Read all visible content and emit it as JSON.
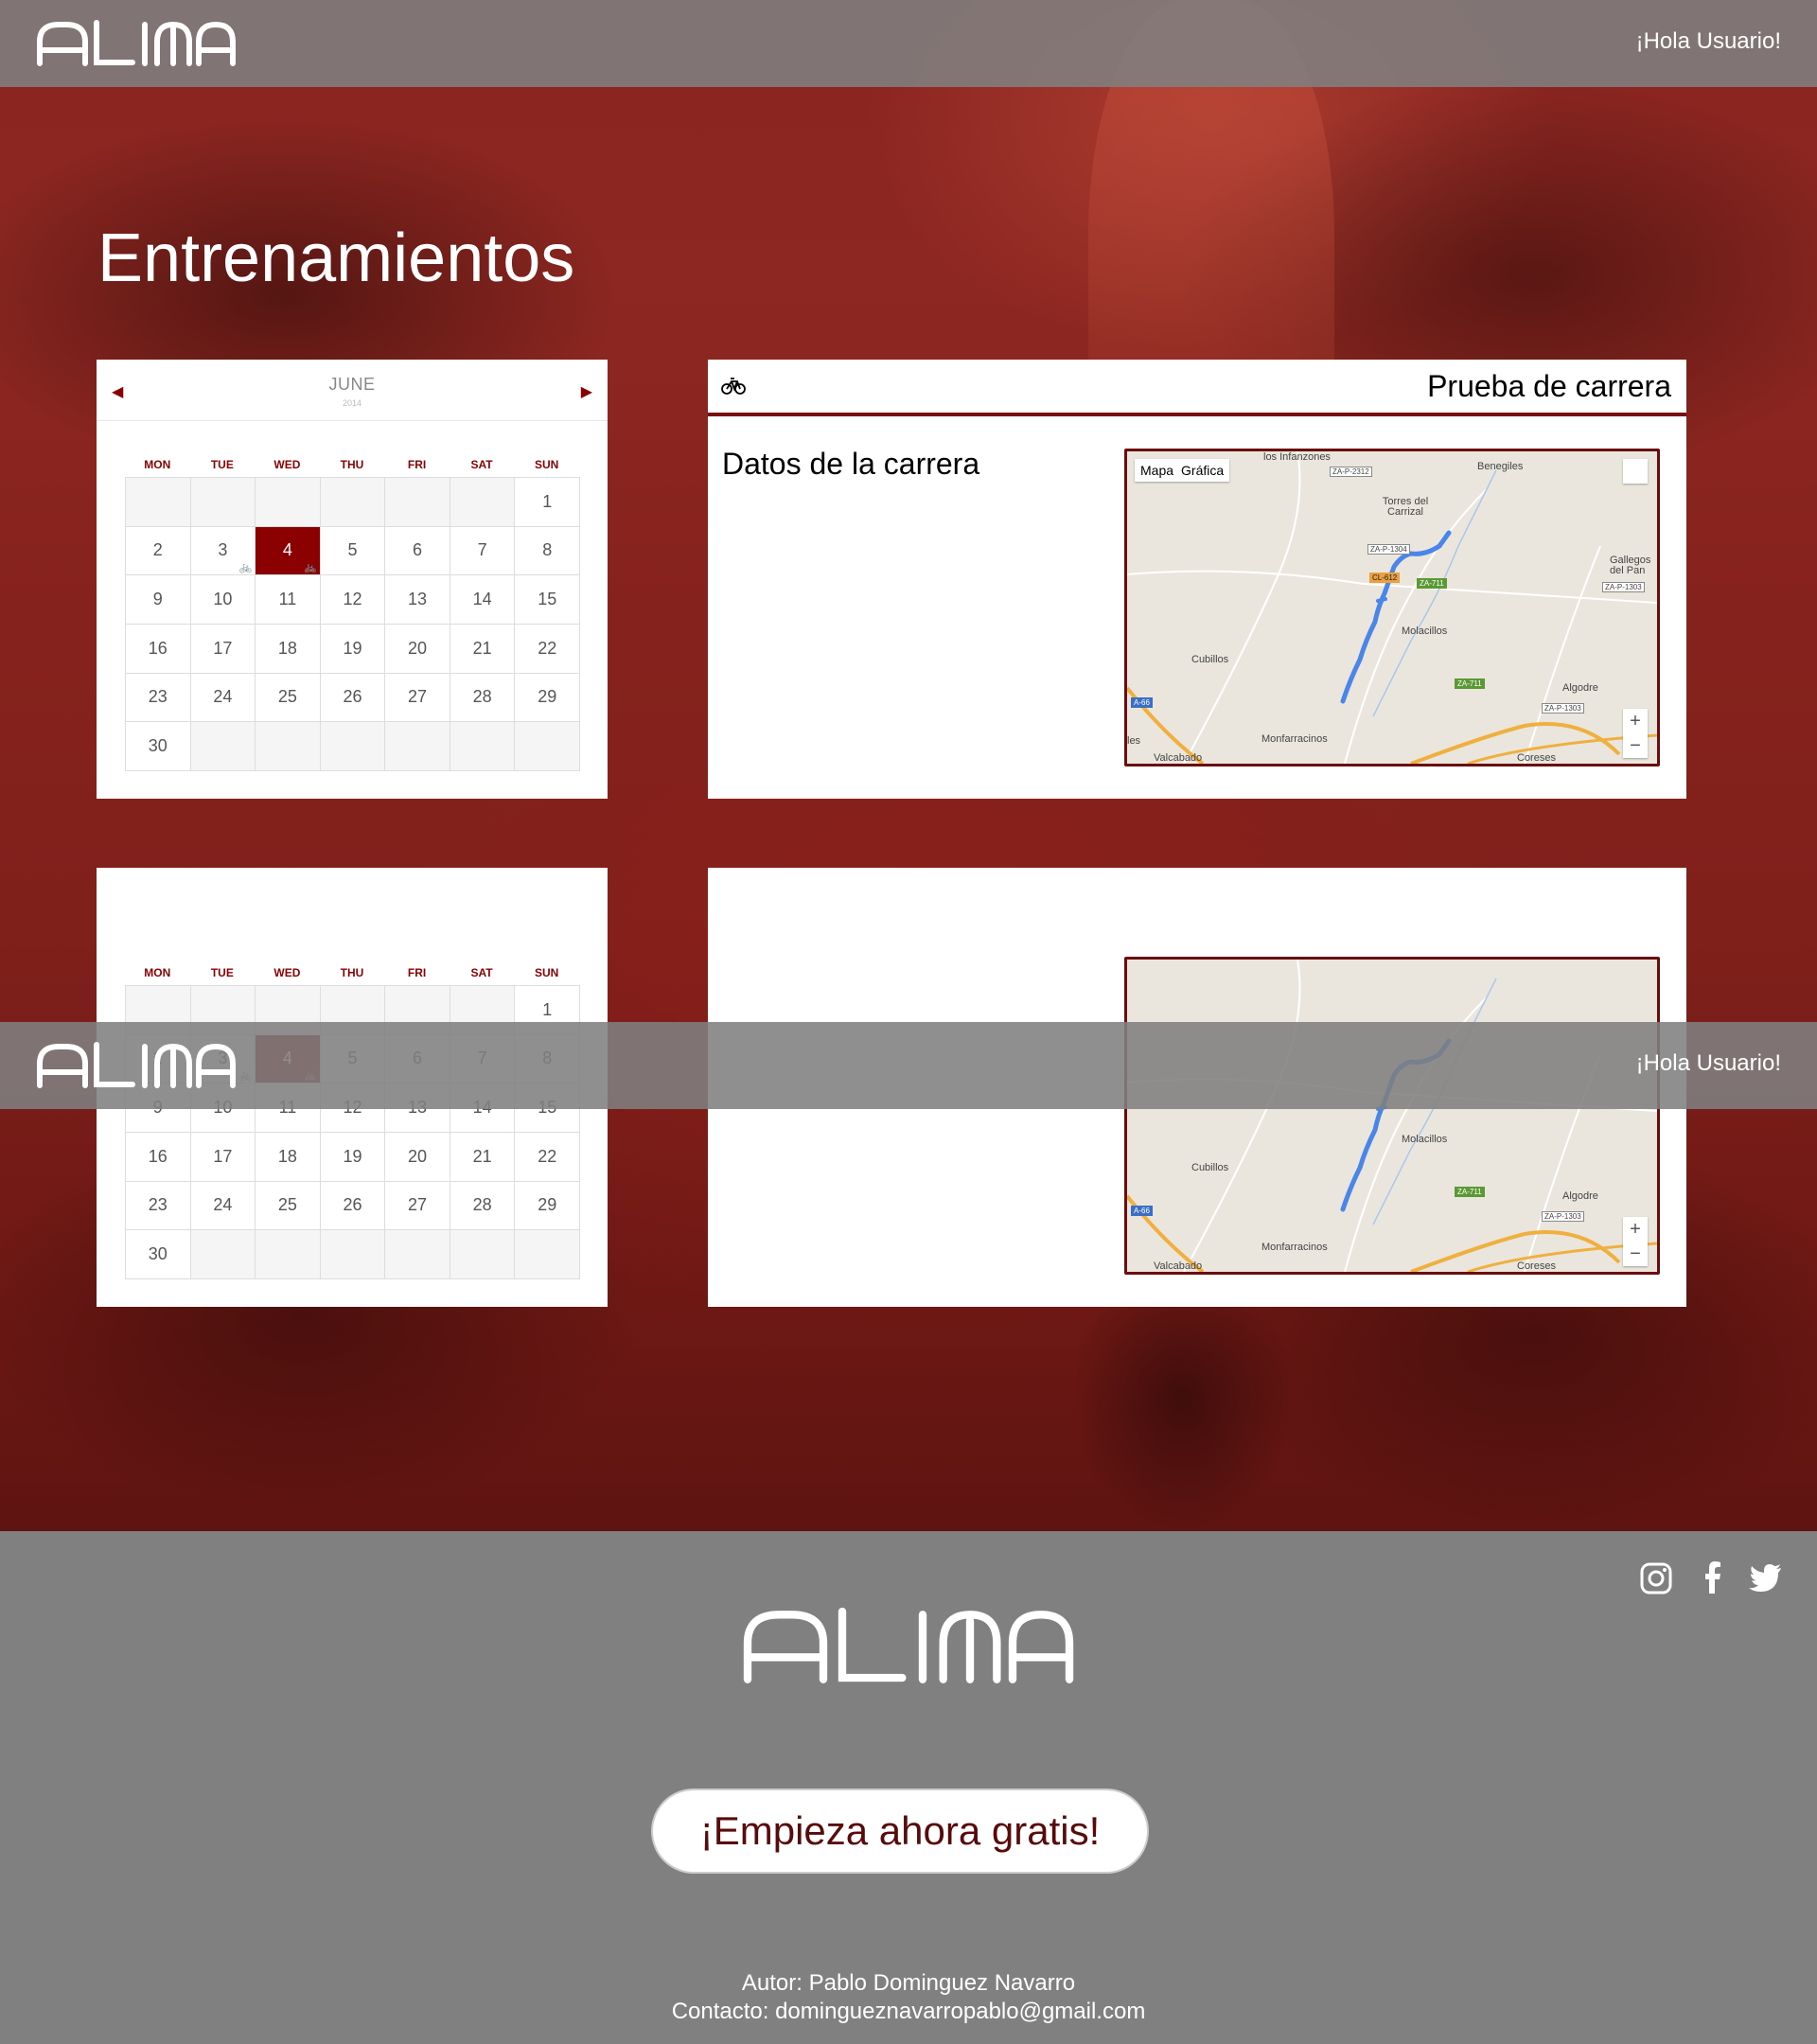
{
  "brand": {
    "logo_text": "ALMA"
  },
  "nav": {
    "greeting": "¡Hola Usuario!"
  },
  "page": {
    "title": "Entrenamientos"
  },
  "calendar": {
    "month": "JUNE",
    "year": "2014",
    "weekdays": [
      "MON",
      "TUE",
      "WED",
      "THU",
      "FRI",
      "SAT",
      "SUN"
    ],
    "selected_day": "4",
    "days": [
      "1",
      "2",
      "3",
      "4",
      "5",
      "6",
      "7",
      "8",
      "9",
      "10",
      "11",
      "12",
      "13",
      "14",
      "15",
      "16",
      "17",
      "18",
      "19",
      "20",
      "21",
      "22",
      "23",
      "24",
      "25",
      "26",
      "27",
      "28",
      "29",
      "30"
    ]
  },
  "race": {
    "title": "Prueba de carrera",
    "subtitle": "Datos de la carrera",
    "icon": "bicycle-icon",
    "map": {
      "tab_map": "Mapa",
      "tab_chart": "Gráfica",
      "places": [
        "los Infanzones",
        "Benegiles",
        "Torres del Carrizal",
        "Gallegos del Pan",
        "Molacillos",
        "Cubillos",
        "Algodre",
        "Monfarracinos",
        "Valcabado",
        "Coreses",
        "les"
      ],
      "roads": [
        "ZA-P-2312",
        "ZA-P-1304",
        "CL-612",
        "ZA-711",
        "ZA-P-1303",
        "ZA-711",
        "ZA-P-1303",
        "A-66"
      ],
      "zoom_in": "+",
      "zoom_out": "−"
    }
  },
  "footer": {
    "cta": "¡Empieza ahora gratis!",
    "author": "Autor: Pablo Dominguez Navarro",
    "contact": "Contacto: domingueznavarropablo@gmail.com",
    "social": [
      "instagram-icon",
      "facebook-icon",
      "twitter-icon"
    ]
  },
  "colors": {
    "accent": "#8b0000",
    "nav_bg": "#808080",
    "footer_bg": "#808080",
    "route": "#4a86e8"
  }
}
